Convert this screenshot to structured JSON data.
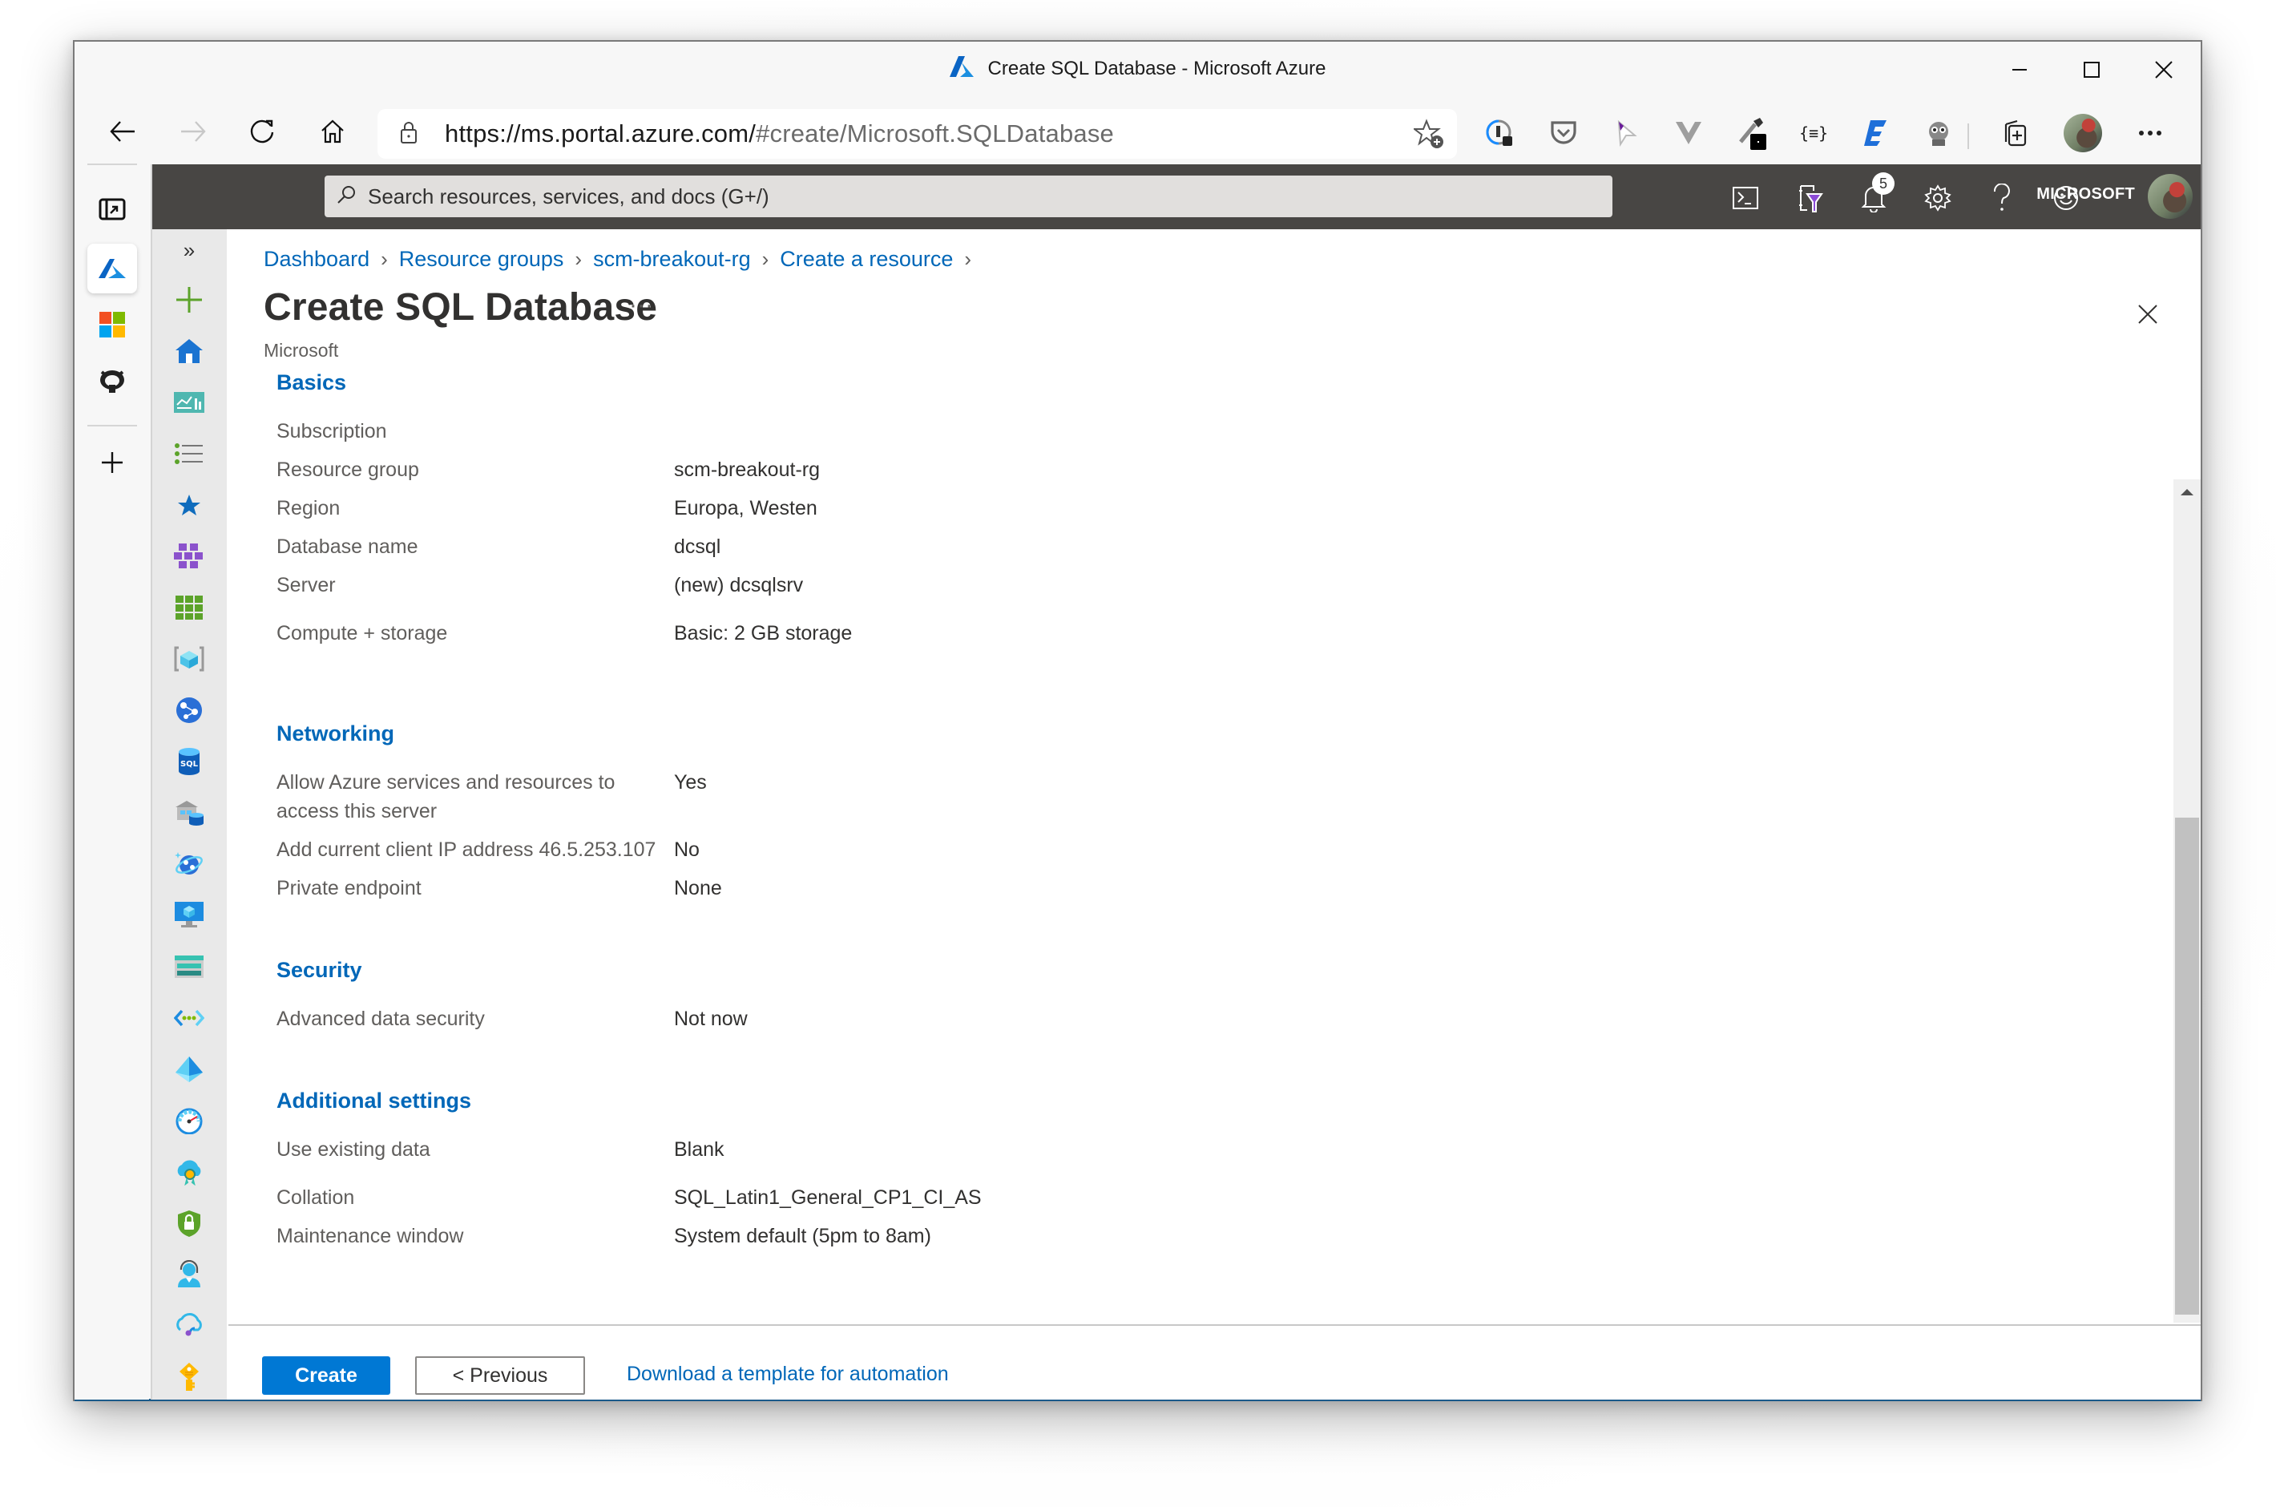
{
  "browser": {
    "window_title": "Create SQL Database - Microsoft Azure",
    "url_host": "https://ms.portal.azure.com/",
    "url_path": "#create/Microsoft.SQLDatabase",
    "window_controls": [
      "minimize",
      "maximize",
      "close"
    ],
    "nav_buttons": [
      "back",
      "forward",
      "refresh",
      "home"
    ],
    "extensions": [
      "favorite-add",
      "1password",
      "pocket",
      "cursor-extension",
      "vue-devtools",
      "color-picker",
      "json-formatter",
      "editor-e",
      "raccoon-extension",
      "collections",
      "profile",
      "more"
    ]
  },
  "vertical_tabs": {
    "items": [
      {
        "name": "tab-actions",
        "icon": "tab-actions-icon"
      },
      {
        "name": "azure-portal",
        "icon": "azure-icon",
        "active": true
      },
      {
        "name": "microsoft",
        "icon": "microsoft-logo-icon"
      },
      {
        "name": "github",
        "icon": "github-icon"
      }
    ],
    "new_tab": "+"
  },
  "portal": {
    "search_placeholder": "Search resources, services, and docs (G+/)",
    "notification_count": "5",
    "tenant": "MICROSOFT",
    "topbar_icons": [
      "cloud-shell",
      "directory-filter",
      "notifications",
      "settings",
      "help",
      "feedback"
    ]
  },
  "sidebar": {
    "expand": "»",
    "items": [
      "create-resource",
      "home",
      "dashboard",
      "all-services",
      "favorites",
      "all-resources",
      "resource-groups",
      "app-services",
      "function-app",
      "sql-databases",
      "sql-data-warehouse",
      "cosmos-db",
      "virtual-machines",
      "load-balancers",
      "virtual-networks",
      "azure-active-directory",
      "monitor",
      "advisor",
      "security-center",
      "help-support",
      "cost-management",
      "key-vaults"
    ]
  },
  "breadcrumb": [
    {
      "label": "Dashboard"
    },
    {
      "label": "Resource groups"
    },
    {
      "label": "scm-breakout-rg"
    },
    {
      "label": "Create a resource"
    }
  ],
  "page": {
    "title": "Create SQL Database",
    "more": "···",
    "subtitle": "Microsoft"
  },
  "sections": {
    "basics": {
      "heading": "Basics",
      "rows": [
        {
          "label": "Subscription",
          "value": ""
        },
        {
          "label": "Resource group",
          "value": "scm-breakout-rg"
        },
        {
          "label": "Region",
          "value": "Europa, Westen"
        },
        {
          "label": "Database name",
          "value": "dcsql"
        },
        {
          "label": "Server",
          "value": "(new) dcsqlsrv"
        },
        {
          "label": "Compute + storage",
          "value": "Basic: 2 GB storage"
        }
      ]
    },
    "networking": {
      "heading": "Networking",
      "rows": [
        {
          "label": "Allow Azure services and resources to access this server",
          "value": "Yes"
        },
        {
          "label": "Add current client IP address 46.5.253.107",
          "value": "No"
        },
        {
          "label": "Private endpoint",
          "value": "None"
        }
      ]
    },
    "security": {
      "heading": "Security",
      "rows": [
        {
          "label": "Advanced data security",
          "value": "Not now"
        }
      ]
    },
    "additional": {
      "heading": "Additional settings",
      "rows": [
        {
          "label": "Use existing data",
          "value": "Blank"
        },
        {
          "label": "Collation",
          "value": "SQL_Latin1_General_CP1_CI_AS"
        },
        {
          "label": "Maintenance window",
          "value": "System default (5pm to 8am)"
        }
      ]
    }
  },
  "footer": {
    "create": "Create",
    "previous": "< Previous",
    "download": "Download a template for automation"
  },
  "scroll": {
    "position_fraction": 0.62
  },
  "colors": {
    "accent": "#0078d4",
    "link": "#0067b8",
    "topbar": "#484644"
  }
}
